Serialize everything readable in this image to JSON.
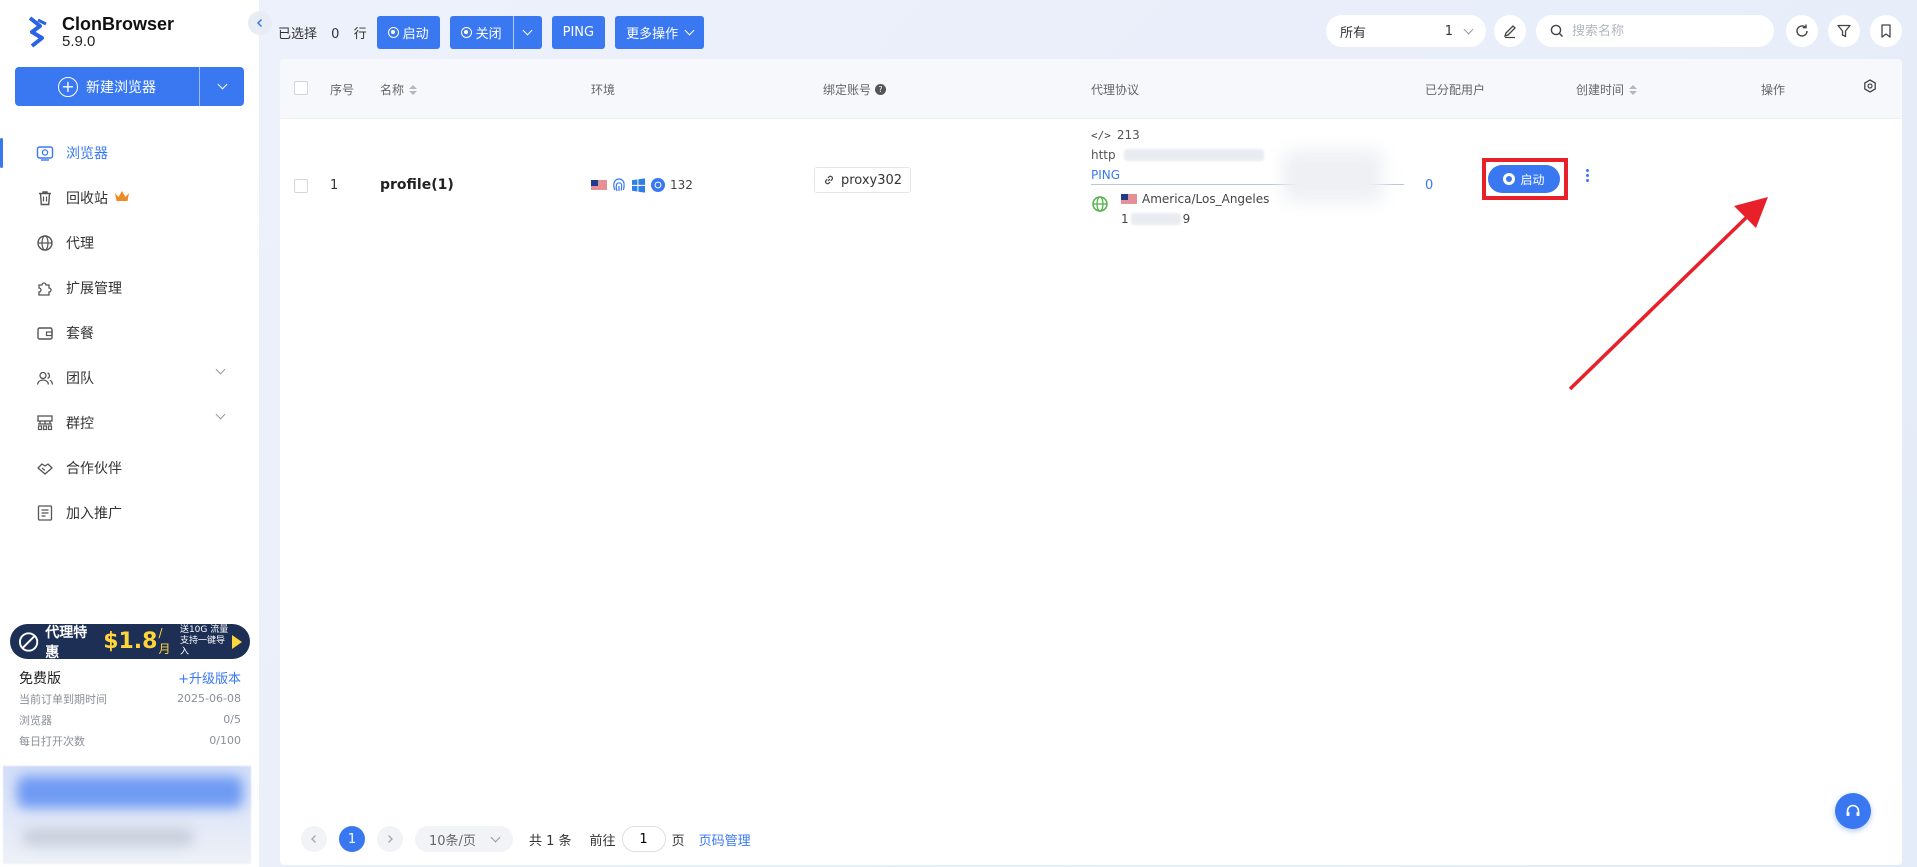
{
  "app": {
    "name": "ClonBrowser",
    "version": "5.9.0"
  },
  "sidebar": {
    "new_browser_label": "新建浏览器",
    "items": [
      {
        "label": "浏览器",
        "icon": "browser-icon",
        "active": true
      },
      {
        "label": "回收站",
        "icon": "trash-icon",
        "badge_icon": "crown-icon"
      },
      {
        "label": "代理",
        "icon": "globe-icon"
      },
      {
        "label": "扩展管理",
        "icon": "puzzle-icon"
      },
      {
        "label": "套餐",
        "icon": "wallet-icon"
      },
      {
        "label": "团队",
        "icon": "team-icon",
        "expandable": true
      },
      {
        "label": "群控",
        "icon": "sitemap-icon",
        "expandable": true
      },
      {
        "label": "合作伙伴",
        "icon": "handshake-icon"
      },
      {
        "label": "加入推广",
        "icon": "promo-icon"
      }
    ],
    "promo": {
      "text": "代理特惠",
      "price": "$1.8",
      "unit": "/月",
      "sub1": "送10G 流量",
      "sub2": "支持一键导入"
    },
    "plan": {
      "name": "免费版",
      "upgrade_label": "+升级版本",
      "rows": [
        {
          "label": "当前订单到期时间",
          "value": "2025-06-08"
        },
        {
          "label": "浏览器",
          "value": "0/5"
        },
        {
          "label": "每日打开次数",
          "value": "0/100"
        }
      ]
    }
  },
  "toolbar": {
    "selected_prefix": "已选择",
    "selected_count": "0",
    "selected_suffix": "行",
    "launch_label": "启动",
    "close_label": "关闭",
    "ping_label": "PING",
    "more_label": "更多操作",
    "filter_value": "所有",
    "filter_count": "1",
    "search_placeholder": "搜索名称"
  },
  "table": {
    "headers": {
      "index": "序号",
      "name": "名称",
      "env": "环境",
      "account": "绑定账号",
      "proxy": "代理协议",
      "assigned": "已分配用户",
      "created": "创建时间",
      "actions": "操作"
    },
    "rows": [
      {
        "index": "1",
        "name": "profile(1)",
        "env_count": "132",
        "account": "proxy302",
        "proxy_id": "213",
        "proxy_type": "http",
        "ping_label": "PING",
        "timezone": "America/Los_Angeles",
        "ip_start": "1",
        "ip_end": "9",
        "assigned": "0",
        "launch_label": "启动"
      }
    ]
  },
  "pagination": {
    "current": "1",
    "page_size": "10条/页",
    "total": "共 1 条",
    "goto_prefix": "前往",
    "goto_value": "1",
    "goto_suffix": "页",
    "manage_label": "页码管理"
  },
  "colors": {
    "accent": "#3a78f2",
    "highlight": "#e8202a",
    "promo_bg": "#1d2f55",
    "promo_price": "#ffd53a"
  }
}
